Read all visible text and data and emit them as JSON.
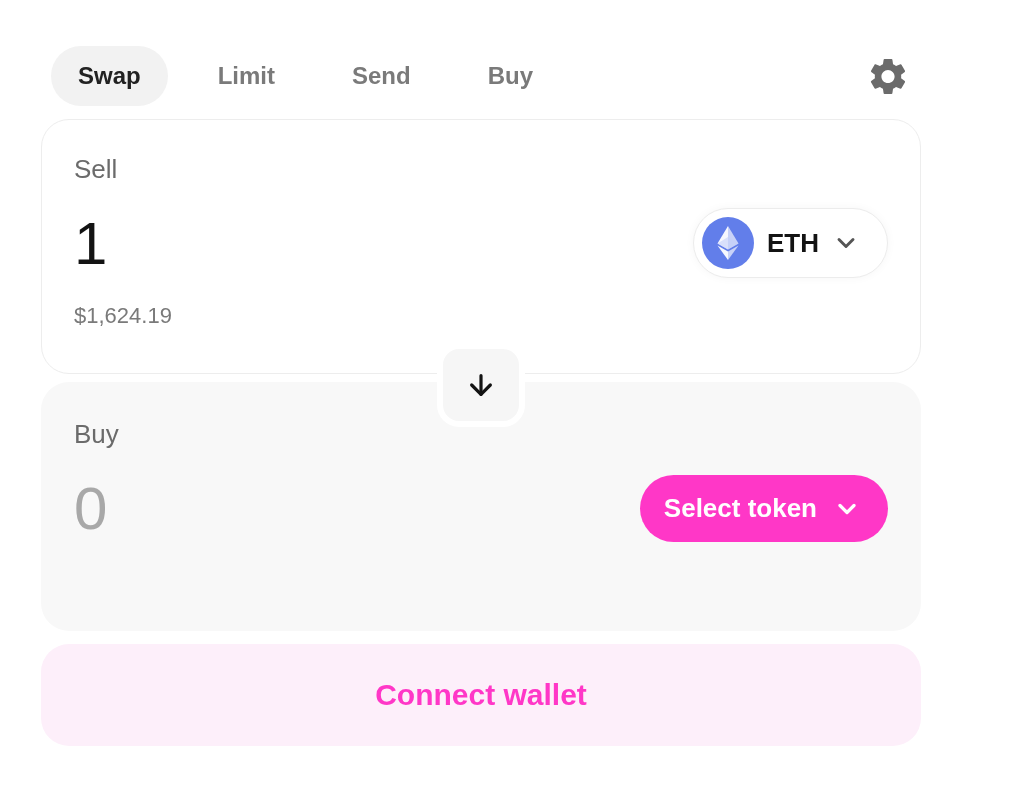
{
  "tabs": [
    {
      "label": "Swap",
      "selected": true
    },
    {
      "label": "Limit",
      "selected": false
    },
    {
      "label": "Send",
      "selected": false
    },
    {
      "label": "Buy",
      "selected": false
    }
  ],
  "sell": {
    "label": "Sell",
    "amount": "1",
    "usd_value": "$1,624.19",
    "token": {
      "symbol": "ETH"
    }
  },
  "buy": {
    "label": "Buy",
    "placeholder": "0",
    "select_button": "Select token"
  },
  "connect_button": "Connect wallet"
}
